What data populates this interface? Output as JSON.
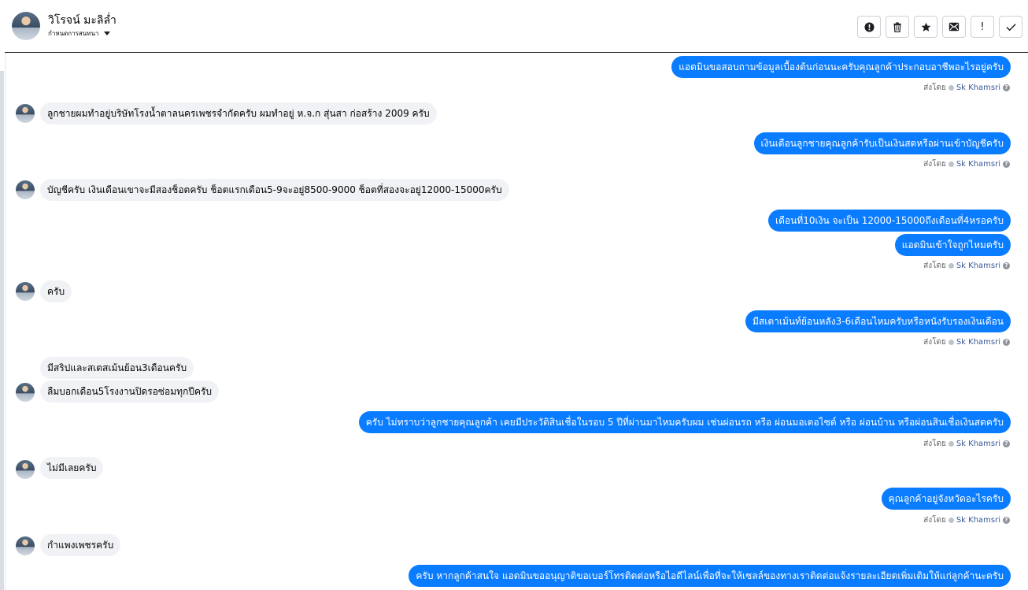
{
  "contact": {
    "name": "วิโรจน์ มะลิล่ำ",
    "conversation_settings": "กำหนดการสนทนา"
  },
  "toolbar": {
    "icons": [
      "alert-circle-icon",
      "trash-icon",
      "star-icon",
      "mark-unread-icon",
      "important-icon",
      "done-check-icon"
    ],
    "glyphs": [
      "!",
      "🗑",
      "★",
      "✉",
      "!",
      "✓"
    ]
  },
  "sent_by": {
    "label": "ส่งโดย",
    "agent": "Sk Khamsri",
    "help": "?"
  },
  "messages": [
    {
      "dir": "out",
      "text": "แอดมินขอสอบถามข้อมูลเบื้องต้นก่อนนะครับคุณลูกค้าประกอบอาชีพอะไรอยู่ครับ"
    },
    {
      "dir": "in",
      "text": "ลูกชายผมทำอยู่บริษัทโรงน้ำตาลนครเพชรจำกัดครับ ผมทำอยู่ ห.จ.ก สุ่นสา ก่อสร้าง 2009 ครับ"
    },
    {
      "dir": "out",
      "text": "เงินเดือนลูกชายคุณลูกค้ารับเป็นเงินสดหรือผ่านเข้าบัญชีครับ"
    },
    {
      "dir": "in",
      "text": "บัญชีครับ เงินเดือนเขาจะมีสองช็อตครับ ช็อตแรกเดือน5-9จะอยู่8500-9000 ช็อตที่สองจะอยู่12000-15000ครับ"
    },
    {
      "dir": "out",
      "text": "เดือนที่10เงิน จะเป็น 12000-15000ถึงเดือนที่4หรอครับ"
    },
    {
      "dir": "out",
      "text": "แอดมินเข้าใจถูกไหมครับ"
    },
    {
      "dir": "in",
      "text": "ครับ"
    },
    {
      "dir": "out",
      "text": "มีสเตาเม้นท์ย้อนหลัง3-6เดือนไหมครับหรือหนังรับรองเงินเดือน"
    },
    {
      "dir": "in",
      "text": "มีสริปและสเตสเม้นย้อน3เดือนครับ"
    },
    {
      "dir": "in",
      "text": "ลืมบอกเดือน5โรงงานปิดรอซ่อมทุกปีครับ"
    },
    {
      "dir": "out",
      "text": "ครับ ไม่ทราบว่าลูกชายคุณลูกค้า เคยมีประวัติสินเชื่อในรอบ 5 ปีที่ผ่านมาไหมครับผม เช่นผ่อนรถ หรือ ผ่อนมอเตอไซด์ หรือ ผ่อนบ้าน หรือผ่อนสินเชื่อเงินสดครับ"
    },
    {
      "dir": "in",
      "text": "ไม่มีเลยครับ"
    },
    {
      "dir": "out",
      "text": "คุณลูกค้าอยู่จังหวัดอะไรครับ"
    },
    {
      "dir": "in",
      "text": "กำแพงเพชรครับ"
    },
    {
      "dir": "out",
      "text": "ครับ หากลูกค้าสนใจ แอดมินขออนุญาติขอเบอร์โทรติดต่อหรือไอดีไลน์เพื่อที่จะให้เซลล์ของทางเราติดต่อแจ้งรายละเอียดเพิ่มเติมให้แก่ลูกค้านะครับ"
    }
  ]
}
